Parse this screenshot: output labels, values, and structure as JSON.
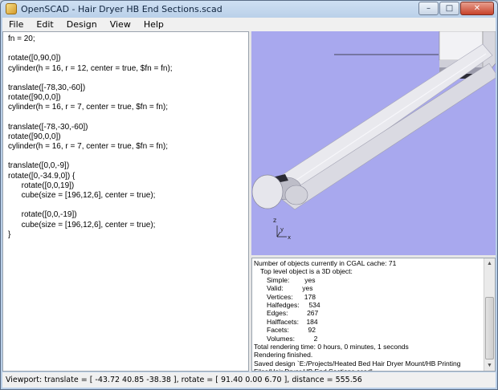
{
  "window": {
    "title": "OpenSCAD - Hair Dryer HB End Sections.scad",
    "controls": {
      "minimize": "–",
      "maximize": "□",
      "close": "✕"
    }
  },
  "menu": [
    "File",
    "Edit",
    "Design",
    "View",
    "Help"
  ],
  "editor": {
    "lines": [
      "fn = 20;",
      "",
      "rotate([0,90,0])",
      "cylinder(h = 16, r = 12, center = true, $fn = fn);",
      "",
      "translate([-78,30,-60])",
      "rotate([90,0,0])",
      "cylinder(h = 16, r = 7, center = true, $fn = fn);",
      "",
      "translate([-78,-30,-60])",
      "rotate([90,0,0])",
      "cylinder(h = 16, r = 7, center = true, $fn = fn);",
      "",
      "translate([0,0,-9])",
      "rotate([0,-34.9,0]) {",
      "      rotate([0,0,19])",
      "      cube(size = [196,12,6], center = true);",
      "",
      "      rotate([0,0,-19])",
      "      cube(size = [196,12,6], center = true);",
      "}"
    ]
  },
  "viewport": {
    "axis_labels": {
      "z": "z",
      "y": "y",
      "x": "x"
    },
    "colors": {
      "background": "#a8a8ee",
      "model": "#e6e6ea"
    }
  },
  "console": {
    "lines": [
      {
        "text": "Number of objects currently in CGAL cache: 71",
        "indent": 0
      },
      {
        "text": "Top level object is a 3D object:",
        "indent": 1
      },
      {
        "text": "Simple:        yes",
        "indent": 2
      },
      {
        "text": "Valid:          yes",
        "indent": 2
      },
      {
        "text": "Vertices:      178",
        "indent": 2
      },
      {
        "text": "Halfedges:     534",
        "indent": 2
      },
      {
        "text": "Edges:          267",
        "indent": 2
      },
      {
        "text": "Halffacets:    184",
        "indent": 2
      },
      {
        "text": "Facets:          92",
        "indent": 2
      },
      {
        "text": "Volumes:          2",
        "indent": 2
      },
      {
        "text": "Total rendering time: 0 hours, 0 minutes, 1 seconds",
        "indent": 0
      },
      {
        "text": "Rendering finished.",
        "indent": 0
      },
      {
        "text": "Saved design `E:/Projects/Heated Bed Hair Dryer Mount/HB Printing",
        "indent": 0
      },
      {
        "text": "Files/Hair Dryer HB End Sections.scad'.",
        "indent": 0
      }
    ]
  },
  "statusbar": {
    "text": "Viewport: translate = [ -43.72 40.85 -38.38 ], rotate = [ 91.40 0.00 6.70 ], distance = 555.56"
  }
}
